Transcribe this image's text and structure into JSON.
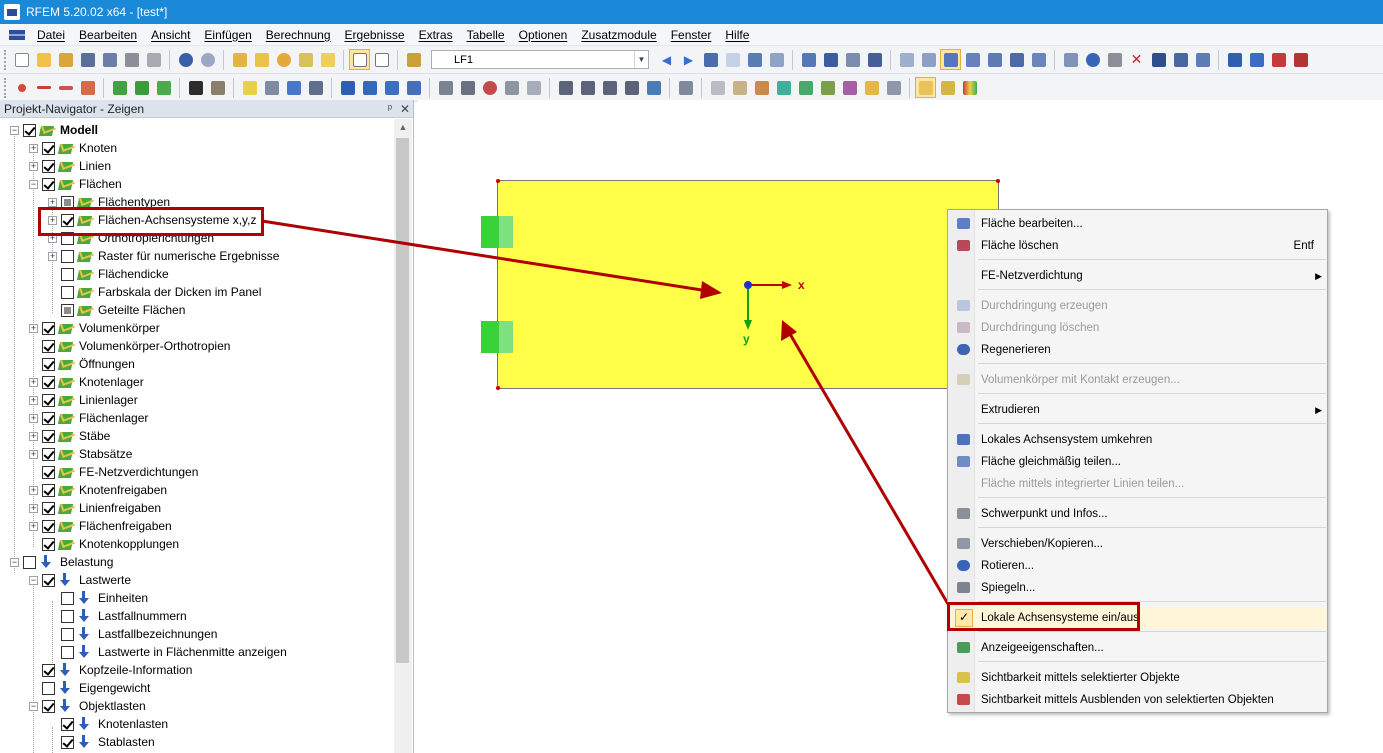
{
  "window": {
    "title": "RFEM 5.20.02 x64 - [test*]"
  },
  "menu": [
    "Datei",
    "Bearbeiten",
    "Ansicht",
    "Einfügen",
    "Berechnung",
    "Ergebnisse",
    "Extras",
    "Tabelle",
    "Optionen",
    "Zusatzmodule",
    "Fenster",
    "Hilfe"
  ],
  "toolbar": {
    "loadcase_combo": "LF1"
  },
  "navigator": {
    "header": "Projekt-Navigator - Zeigen",
    "pin": "ᵖ",
    "close": "✕",
    "items": [
      {
        "label": "Modell"
      },
      {
        "label": "Knoten"
      },
      {
        "label": "Linien"
      },
      {
        "label": "Flächen"
      },
      {
        "label": "Flächentypen"
      },
      {
        "label": "Flächen-Achsensysteme x,y,z"
      },
      {
        "label": "Orthotropierichtungen"
      },
      {
        "label": "Raster für numerische Ergebnisse"
      },
      {
        "label": "Flächendicke"
      },
      {
        "label": "Farbskala der Dicken im Panel"
      },
      {
        "label": "Geteilte Flächen"
      },
      {
        "label": "Volumenkörper"
      },
      {
        "label": "Volumenkörper-Orthotropien"
      },
      {
        "label": "Öffnungen"
      },
      {
        "label": "Knotenlager"
      },
      {
        "label": "Linienlager"
      },
      {
        "label": "Flächenlager"
      },
      {
        "label": "Stäbe"
      },
      {
        "label": "Stabsätze"
      },
      {
        "label": "FE-Netzverdichtungen"
      },
      {
        "label": "Knotenfreigaben"
      },
      {
        "label": "Linienfreigaben"
      },
      {
        "label": "Flächenfreigaben"
      },
      {
        "label": "Knotenkopplungen"
      },
      {
        "label": "Belastung"
      },
      {
        "label": "Lastwerte"
      },
      {
        "label": "Einheiten"
      },
      {
        "label": "Lastfallnummern"
      },
      {
        "label": "Lastfallbezeichnungen"
      },
      {
        "label": "Lastwerte in Flächenmitte anzeigen"
      },
      {
        "label": "Kopfzeile-Information"
      },
      {
        "label": "Eigengewicht"
      },
      {
        "label": "Objektlasten"
      },
      {
        "label": "Knotenlasten"
      },
      {
        "label": "Stablasten"
      }
    ]
  },
  "axes": {
    "x": "x",
    "y": "y"
  },
  "context_menu": {
    "items": [
      {
        "label": "Fläche bearbeiten..."
      },
      {
        "label": "Fläche löschen",
        "shortcut": "Entf"
      },
      {
        "label": "FE-Netzverdichtung",
        "submenu": "▶"
      },
      {
        "label": "Durchdringung erzeugen"
      },
      {
        "label": "Durchdringung löschen"
      },
      {
        "label": "Regenerieren"
      },
      {
        "label": "Volumenkörper mit Kontakt erzeugen..."
      },
      {
        "label": "Extrudieren",
        "submenu": "▶"
      },
      {
        "label": "Lokales Achsensystem umkehren"
      },
      {
        "label": "Fläche gleichmäßig teilen..."
      },
      {
        "label": "Fläche mittels integrierter Linien teilen..."
      },
      {
        "label": "Schwerpunkt und Infos..."
      },
      {
        "label": "Verschieben/Kopieren..."
      },
      {
        "label": "Rotieren..."
      },
      {
        "label": "Spiegeln..."
      },
      {
        "label": "Lokale Achsensysteme ein/aus",
        "check": "✓"
      },
      {
        "label": "Anzeigeeigenschaften..."
      },
      {
        "label": "Sichtbarkeit mittels selektierter Objekte"
      },
      {
        "label": "Sichtbarkeit mittels Ausblenden von selektierten Objekten"
      }
    ]
  }
}
